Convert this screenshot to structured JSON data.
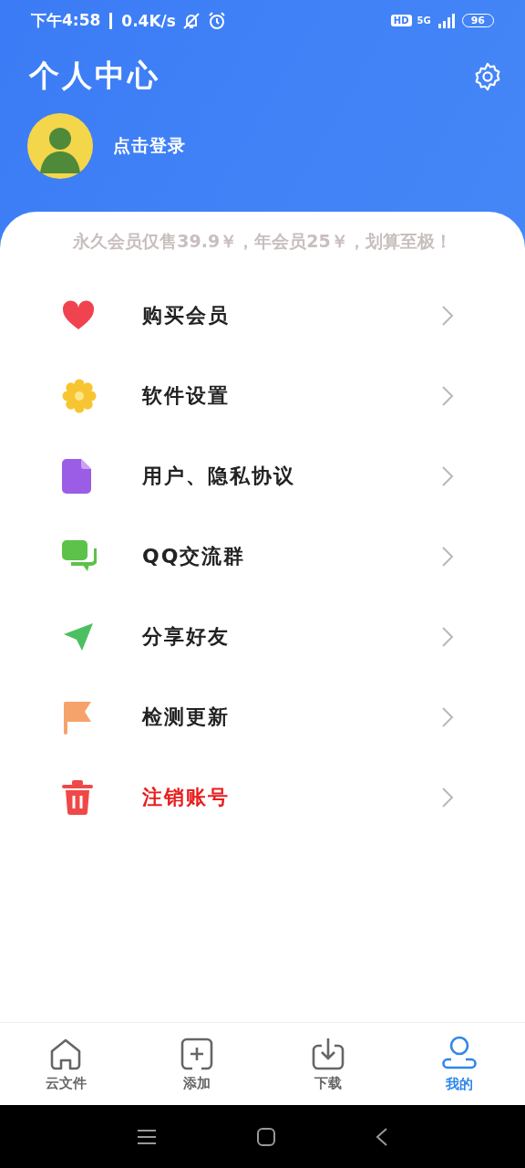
{
  "status_bar": {
    "time": "下午4:58",
    "speed": "0.4K/s",
    "hd": "HD",
    "network": "5G",
    "battery": "96"
  },
  "header": {
    "title": "个人中心",
    "login": "点击登录"
  },
  "banner": "永久会员仅售39.9￥，年会员25￥，划算至极！",
  "menu": [
    {
      "label": "购买会员",
      "danger": false
    },
    {
      "label": "软件设置",
      "danger": false
    },
    {
      "label": "用户、隐私协议",
      "danger": false
    },
    {
      "label": "QQ交流群",
      "danger": false
    },
    {
      "label": "分享好友",
      "danger": false
    },
    {
      "label": "检测更新",
      "danger": false
    },
    {
      "label": "注销账号",
      "danger": true
    }
  ],
  "tabs": [
    {
      "label": "云文件",
      "selected": false
    },
    {
      "label": "添加",
      "selected": false
    },
    {
      "label": "下载",
      "selected": false
    },
    {
      "label": "我的",
      "selected": true
    }
  ]
}
